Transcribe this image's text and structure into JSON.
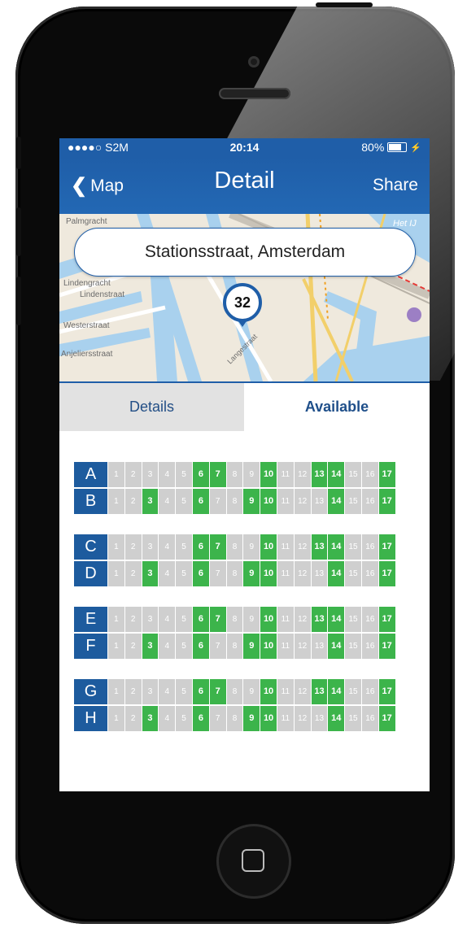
{
  "status_bar": {
    "carrier": "●●●●○ S2M",
    "time": "20:14",
    "battery": "80%",
    "battery_level": 0.8
  },
  "nav": {
    "back_label": "Map",
    "title": "Detail",
    "share_label": "Share"
  },
  "map": {
    "address": "Stationsstraat, Amsterdam",
    "pin_count": "32",
    "street_labels": [
      "Palmgracht",
      "Lindengracht",
      "Lindenstraat",
      "Westerstraat",
      "Anjeliersstraat",
      "Langestraat",
      "Het IJ"
    ]
  },
  "tabs": [
    {
      "label": "Details",
      "active": false
    },
    {
      "label": "Available",
      "active": true
    }
  ],
  "slot_numbers": [
    "1",
    "2",
    "3",
    "4",
    "5",
    "6",
    "7",
    "8",
    "9",
    "10",
    "11",
    "12",
    "13",
    "14",
    "15",
    "16",
    "17"
  ],
  "groups": [
    {
      "rows": [
        {
          "label": "A",
          "available": [
            6,
            7,
            10,
            13,
            14,
            17
          ]
        },
        {
          "label": "B",
          "available": [
            3,
            6,
            9,
            10,
            14,
            17
          ]
        }
      ]
    },
    {
      "rows": [
        {
          "label": "C",
          "available": [
            6,
            7,
            10,
            13,
            14,
            17
          ]
        },
        {
          "label": "D",
          "available": [
            3,
            6,
            9,
            10,
            14,
            17
          ]
        }
      ]
    },
    {
      "rows": [
        {
          "label": "E",
          "available": [
            6,
            7,
            10,
            13,
            14,
            17
          ]
        },
        {
          "label": "F",
          "available": [
            3,
            6,
            9,
            10,
            14,
            17
          ]
        }
      ]
    },
    {
      "rows": [
        {
          "label": "G",
          "available": [
            6,
            7,
            10,
            13,
            14,
            17
          ]
        },
        {
          "label": "H",
          "available": [
            3,
            6,
            9,
            10,
            14,
            17
          ]
        }
      ]
    }
  ],
  "colors": {
    "primary": "#1f5ea8",
    "available": "#3cb44b",
    "unavailable": "#cfcfcf"
  }
}
